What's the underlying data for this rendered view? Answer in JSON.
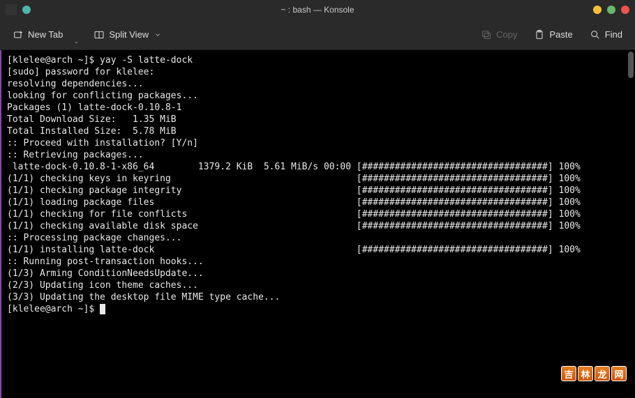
{
  "window": {
    "title": "~ : bash — Konsole"
  },
  "toolbar": {
    "new_tab": "New Tab",
    "split_view": "Split View",
    "copy": "Copy",
    "paste": "Paste",
    "find": "Find"
  },
  "terminal": {
    "lines": [
      "[klelee@arch ~]$ yay -S latte-dock",
      "[sudo] password for klelee:",
      "resolving dependencies...",
      "looking for conflicting packages...",
      "",
      "Packages (1) latte-dock-0.10.8-1",
      "",
      "Total Download Size:   1.35 MiB",
      "Total Installed Size:  5.78 MiB",
      "",
      ":: Proceed with installation? [Y/n]",
      ":: Retrieving packages...",
      " latte-dock-0.10.8-1-x86_64        1379.2 KiB  5.61 MiB/s 00:00 [##################################] 100%",
      "(1/1) checking keys in keyring                                  [##################################] 100%",
      "(1/1) checking package integrity                                [##################################] 100%",
      "(1/1) loading package files                                     [##################################] 100%",
      "(1/1) checking for file conflicts                               [##################################] 100%",
      "(1/1) checking available disk space                             [##################################] 100%",
      ":: Processing package changes...",
      "(1/1) installing latte-dock                                     [##################################] 100%",
      ":: Running post-transaction hooks...",
      "(1/3) Arming ConditionNeedsUpdate...",
      "(2/3) Updating icon theme caches...",
      "(3/3) Updating the desktop file MIME type cache..."
    ],
    "prompt": "[klelee@arch ~]$ "
  },
  "watermark": {
    "chars": [
      "吉",
      "林",
      "龙",
      "网"
    ]
  }
}
